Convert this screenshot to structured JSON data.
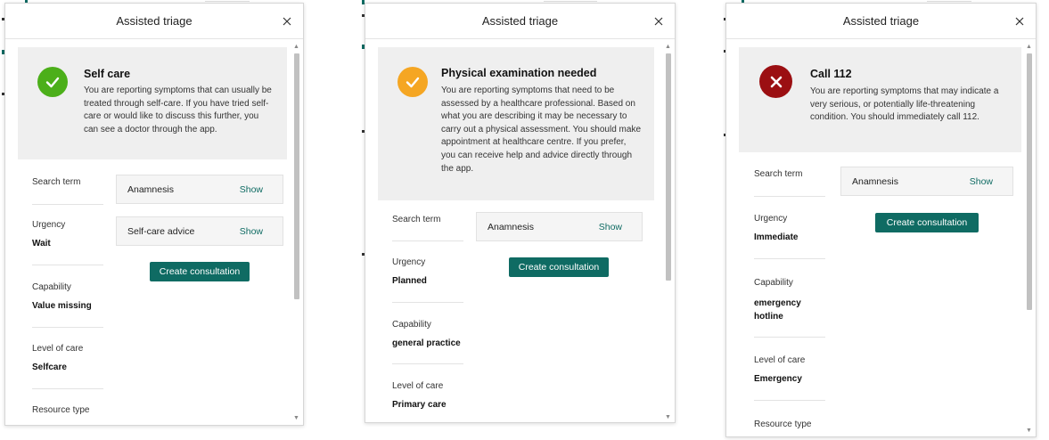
{
  "panels": [
    {
      "title": "Assisted triage",
      "banner": {
        "title": "Self care",
        "description": "You are reporting symptoms that can usually be treated through self-care. If you have tried self-care or would like to discuss this further, you can see a doctor through the app.",
        "icon": "checkmark-icon",
        "color": "#4caf1a"
      },
      "fields": [
        {
          "label": "Search term",
          "value": ""
        },
        {
          "label": "Urgency",
          "value": "Wait"
        },
        {
          "label": "Capability",
          "value": "Value missing"
        },
        {
          "label": "Level of care",
          "value": "Selfcare"
        },
        {
          "label": "Resource type",
          "value": ""
        }
      ],
      "items": [
        {
          "label": "Anamnesis",
          "action": "Show"
        },
        {
          "label": "Self-care advice",
          "action": "Show"
        }
      ],
      "button": "Create consultation"
    },
    {
      "title": "Assisted triage",
      "banner": {
        "title": "Physical examination needed",
        "description": "You are reporting symptoms that need to be assessed by a healthcare professional. Based on what you are describing it may be necessary to carry out a physical assessment. You should make appointment at healthcare centre. If you prefer, you can receive help and advice directly through the app.",
        "icon": "checkmark-icon",
        "color": "#f5a623"
      },
      "fields": [
        {
          "label": "Search term",
          "value": ""
        },
        {
          "label": "Urgency",
          "value": "Planned"
        },
        {
          "label": "Capability",
          "value": "general practice"
        },
        {
          "label": "Level of care",
          "value": "Primary care"
        }
      ],
      "items": [
        {
          "label": "Anamnesis",
          "action": "Show"
        }
      ],
      "button": "Create consultation"
    },
    {
      "title": "Assisted triage",
      "banner": {
        "title": "Call 112",
        "description": "You are reporting symptoms that may indicate a very serious, or potentially life-threatening condition. You should immediately call 112.",
        "icon": "cross-icon",
        "color": "#9b0f12"
      },
      "fields": [
        {
          "label": "Search term",
          "value": ""
        },
        {
          "label": "Urgency",
          "value": "Immediate"
        },
        {
          "label": "Capability",
          "value": "emergency hotline"
        },
        {
          "label": "Level of care",
          "value": "Emergency"
        },
        {
          "label": "Resource type",
          "value": ""
        }
      ],
      "items": [
        {
          "label": "Anamnesis",
          "action": "Show"
        }
      ],
      "button": "Create consultation"
    }
  ],
  "accent_color": "#0f6b63"
}
